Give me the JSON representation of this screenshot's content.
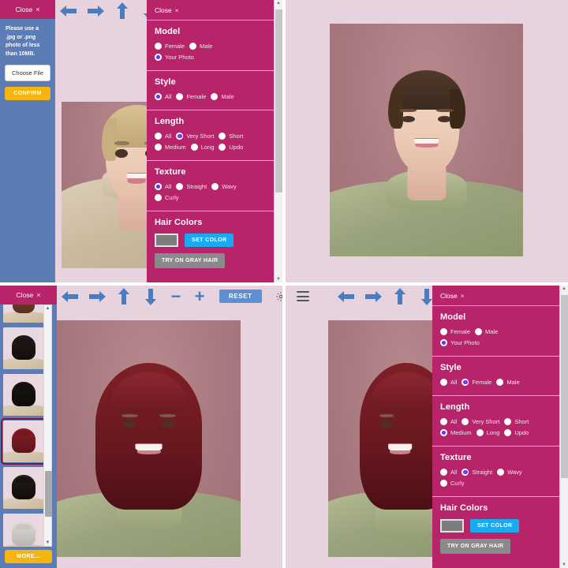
{
  "app": {
    "accent_magenta": "#b8246a",
    "sidebar_blue": "#5b7cb4",
    "confirm_yellow": "#f5b50e",
    "set_color_blue": "#19aaf0",
    "arrow_blue": "#4a7cc0",
    "stage_bg": "#e6d3dd",
    "photo_bg": "#ab7f84"
  },
  "close": {
    "label": "Close",
    "x_glyph": "×"
  },
  "upload": {
    "close_label": "Close",
    "note": "Please use a .jpg or .png photo of less than 10MB.",
    "choose_file_label": "Choose File",
    "confirm_label": "CONFIRM"
  },
  "toolbar": {
    "left_arrow": "←",
    "right_arrow": "→",
    "up_arrow": "↑",
    "down_arrow": "↓",
    "minus": "−",
    "plus": "+",
    "reset_label": "RESET",
    "gear_name": "gear-icon",
    "menu_name": "hamburger-icon"
  },
  "thumbs": {
    "more_label": "MORE...",
    "selected_index": 3,
    "items": [
      {
        "name": "style-thumb-1",
        "hair": "#6b3a2a",
        "len": "short"
      },
      {
        "name": "style-thumb-2",
        "hair": "#1a1412",
        "len": "bob"
      },
      {
        "name": "style-thumb-3",
        "hair": "#120f0e",
        "len": "bob"
      },
      {
        "name": "style-thumb-4",
        "hair": "#7c1b22",
        "len": "bob"
      },
      {
        "name": "style-thumb-5",
        "hair": "#17120f",
        "len": "bob"
      },
      {
        "name": "style-thumb-6",
        "hair": "#c9c6c2",
        "len": "bob"
      }
    ]
  },
  "panel_top": {
    "close_label": "Close",
    "sections": [
      {
        "title": "Model",
        "options": [
          {
            "label": "Female",
            "selected": false
          },
          {
            "label": "Male",
            "selected": false
          },
          {
            "label": "Your Photo",
            "selected": true
          }
        ]
      },
      {
        "title": "Style",
        "options": [
          {
            "label": "All",
            "selected": true
          },
          {
            "label": "Female",
            "selected": false
          },
          {
            "label": "Male",
            "selected": false
          }
        ]
      },
      {
        "title": "Length",
        "options": [
          {
            "label": "All",
            "selected": false
          },
          {
            "label": "Very Short",
            "selected": true
          },
          {
            "label": "Short",
            "selected": false
          },
          {
            "label": "Medium",
            "selected": false
          },
          {
            "label": "Long",
            "selected": false
          },
          {
            "label": "Updo",
            "selected": false
          }
        ]
      },
      {
        "title": "Texture",
        "options": [
          {
            "label": "All",
            "selected": true
          },
          {
            "label": "Straight",
            "selected": false
          },
          {
            "label": "Wavy",
            "selected": false
          },
          {
            "label": "Curly",
            "selected": false
          }
        ]
      }
    ],
    "hair_colors": {
      "title": "Hair Colors",
      "swatch_color": "#7d7d7d",
      "set_color_label": "SET COLOR",
      "gray_hair_label": "TRY ON GRAY HAIR"
    }
  },
  "panel_bottom": {
    "close_label": "Close",
    "sections": [
      {
        "title": "Model",
        "options": [
          {
            "label": "Female",
            "selected": false
          },
          {
            "label": "Male",
            "selected": false
          },
          {
            "label": "Your Photo",
            "selected": true
          }
        ]
      },
      {
        "title": "Style",
        "options": [
          {
            "label": "All",
            "selected": false
          },
          {
            "label": "Female",
            "selected": true
          },
          {
            "label": "Male",
            "selected": false
          }
        ]
      },
      {
        "title": "Length",
        "options": [
          {
            "label": "All",
            "selected": false
          },
          {
            "label": "Very Short",
            "selected": false
          },
          {
            "label": "Short",
            "selected": false
          },
          {
            "label": "Medium",
            "selected": true
          },
          {
            "label": "Long",
            "selected": false
          },
          {
            "label": "Updo",
            "selected": false
          }
        ]
      },
      {
        "title": "Texture",
        "options": [
          {
            "label": "All",
            "selected": false
          },
          {
            "label": "Straight",
            "selected": true
          },
          {
            "label": "Wavy",
            "selected": false
          },
          {
            "label": "Curly",
            "selected": false
          }
        ]
      }
    ],
    "hair_colors": {
      "title": "Hair Colors",
      "swatch_color": "#7d7d7d",
      "set_color_label": "SET COLOR",
      "gray_hair_label": "TRY ON GRAY HAIR"
    }
  },
  "photos": {
    "top_left": {
      "name": "portrait-short-blonde",
      "hair": "#c8b08a",
      "style": "pixie"
    },
    "top_right": {
      "name": "portrait-slicked-brown",
      "hair": "#3b2a20",
      "style": "slicked"
    },
    "bottom_left": {
      "name": "portrait-red-bob",
      "hair": "#6e1a23",
      "style": "bob-bangs"
    },
    "bottom_right": {
      "name": "portrait-red-bob",
      "hair": "#6e1a23",
      "style": "bob-bangs"
    }
  }
}
